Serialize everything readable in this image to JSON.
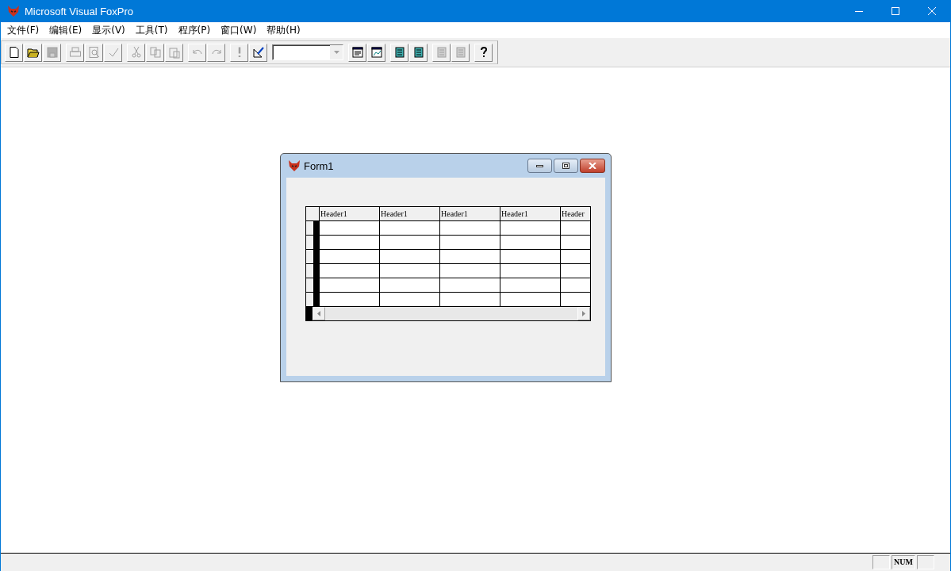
{
  "window": {
    "title": "Microsoft Visual FoxPro"
  },
  "menu": [
    {
      "label": "文件(F)"
    },
    {
      "label": "编辑(E)"
    },
    {
      "label": "显示(V)"
    },
    {
      "label": "工具(T)"
    },
    {
      "label": "程序(P)"
    },
    {
      "label": "窗口(W)"
    },
    {
      "label": "帮助(H)"
    }
  ],
  "toolbar": [
    {
      "kind": "buttons",
      "buttons": [
        {
          "kind": "new",
          "disabled": false
        },
        {
          "kind": "open",
          "disabled": false
        },
        {
          "kind": "save",
          "disabled": true
        }
      ]
    },
    {
      "kind": "buttons",
      "buttons": [
        {
          "kind": "print",
          "disabled": true
        },
        {
          "kind": "preview",
          "disabled": true
        },
        {
          "kind": "spell",
          "disabled": true
        }
      ]
    },
    {
      "kind": "buttons",
      "buttons": [
        {
          "kind": "cut",
          "disabled": true
        },
        {
          "kind": "copy",
          "disabled": true
        },
        {
          "kind": "paste",
          "disabled": true
        }
      ]
    },
    {
      "kind": "buttons",
      "buttons": [
        {
          "kind": "undo",
          "disabled": true
        },
        {
          "kind": "redo",
          "disabled": true
        }
      ]
    },
    {
      "kind": "buttons",
      "buttons": [
        {
          "kind": "run",
          "disabled": true
        },
        {
          "kind": "wizard",
          "disabled": false
        }
      ]
    },
    {
      "kind": "combo"
    },
    {
      "kind": "buttons",
      "buttons": [
        {
          "kind": "window",
          "disabled": false
        },
        {
          "kind": "data",
          "disabled": false
        }
      ]
    },
    {
      "kind": "buttons",
      "buttons": [
        {
          "kind": "builder",
          "disabled": false
        },
        {
          "kind": "builder2",
          "disabled": false
        }
      ]
    },
    {
      "kind": "buttons",
      "buttons": [
        {
          "kind": "table",
          "disabled": true
        },
        {
          "kind": "edit",
          "disabled": true
        }
      ]
    },
    {
      "kind": "buttons",
      "buttons": [
        {
          "kind": "help",
          "disabled": false
        }
      ]
    }
  ],
  "form": {
    "title": "Form1",
    "grid": {
      "columns": [
        "Header1",
        "Header1",
        "Header1",
        "Header1",
        "Header"
      ]
    }
  },
  "status_bar": {
    "indicators": [
      "NUM"
    ]
  }
}
